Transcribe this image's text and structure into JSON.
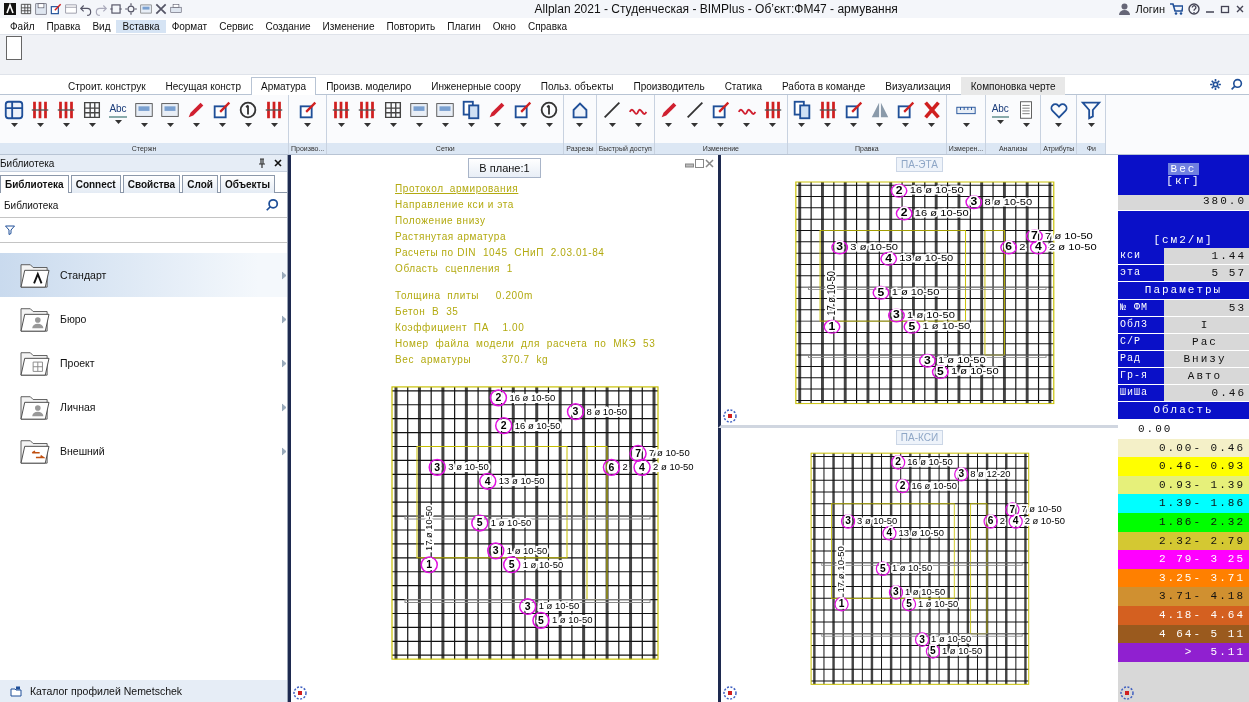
{
  "window": {
    "title": "Allplan 2021 - Студенческая - BIMPlus - Об’єкт:ФМ47 - армування",
    "user": "Логин"
  },
  "quick_tools": [
    {
      "kind": "grid"
    },
    {
      "kind": "save"
    },
    {
      "kind": "edit"
    },
    {
      "kind": "window"
    },
    {
      "kind": "undo"
    },
    {
      "kind": "redo"
    },
    {
      "kind": "frame"
    },
    {
      "kind": "view"
    },
    {
      "kind": "panel"
    },
    {
      "kind": "tools"
    },
    {
      "kind": "print"
    }
  ],
  "menu": [
    {
      "label": "Файл",
      "selected": false
    },
    {
      "label": "Правка",
      "selected": false
    },
    {
      "label": "Вид",
      "selected": false
    },
    {
      "label": "Вставка",
      "selected": true
    },
    {
      "label": "Формат",
      "selected": false
    },
    {
      "label": "Сервис",
      "selected": false
    },
    {
      "label": "Создание",
      "selected": false
    },
    {
      "label": "Изменение",
      "selected": false
    },
    {
      "label": "Повторить",
      "selected": false
    },
    {
      "label": "Плагин",
      "selected": false
    },
    {
      "label": "Окно",
      "selected": false
    },
    {
      "label": "Справка",
      "selected": false
    }
  ],
  "ribbon_tabs": [
    {
      "label": "Строит. конструк",
      "selected": false,
      "kind": "normal"
    },
    {
      "label": "Несущая констр",
      "selected": false,
      "kind": "normal"
    },
    {
      "label": "Арматура",
      "selected": true,
      "kind": "normal"
    },
    {
      "label": "Произв. моделиро",
      "selected": false,
      "kind": "normal"
    },
    {
      "label": "Инженерные соору",
      "selected": false,
      "kind": "normal"
    },
    {
      "label": "Польз. объекты",
      "selected": false,
      "kind": "normal"
    },
    {
      "label": "Производитель",
      "selected": false,
      "kind": "normal"
    },
    {
      "label": "Статика",
      "selected": false,
      "kind": "normal"
    },
    {
      "label": "Работа в команде",
      "selected": false,
      "kind": "normal"
    },
    {
      "label": "Визуализация",
      "selected": false,
      "kind": "normal"
    },
    {
      "label": "Компоновка черте",
      "selected": false,
      "kind": "contextual"
    }
  ],
  "ribbon_groups": [
    {
      "label": "Стержн",
      "tools": [
        {
          "kind": "cube"
        },
        {
          "kind": "bars"
        },
        {
          "kind": "bars"
        },
        {
          "kind": "grid"
        },
        {
          "kind": "text",
          "label": "Abc"
        },
        {
          "kind": "panel"
        },
        {
          "kind": "panel"
        },
        {
          "kind": "pencil"
        },
        {
          "kind": "edit"
        },
        {
          "kind": "number"
        },
        {
          "kind": "bars"
        }
      ]
    },
    {
      "label": "Произво...",
      "tools": [
        {
          "kind": "edit"
        }
      ]
    },
    {
      "label": "Сетки",
      "tools": [
        {
          "kind": "bars"
        },
        {
          "kind": "bars"
        },
        {
          "kind": "grid"
        },
        {
          "kind": "panel"
        },
        {
          "kind": "panel"
        },
        {
          "kind": "copy"
        },
        {
          "kind": "pencil"
        },
        {
          "kind": "edit"
        },
        {
          "kind": "number"
        }
      ]
    },
    {
      "label": "Разрезы",
      "tools": [
        {
          "kind": "house"
        }
      ]
    },
    {
      "label": "Быстрый доступ",
      "tools": [
        {
          "kind": "line"
        },
        {
          "kind": "wave"
        }
      ]
    },
    {
      "label": "Изменение",
      "tools": [
        {
          "kind": "pencil"
        },
        {
          "kind": "line"
        },
        {
          "kind": "edit"
        },
        {
          "kind": "wave"
        },
        {
          "kind": "bars"
        }
      ]
    },
    {
      "label": "Правка",
      "tools": [
        {
          "kind": "copy"
        },
        {
          "kind": "bars"
        },
        {
          "kind": "edit"
        },
        {
          "kind": "mirror"
        },
        {
          "kind": "edit"
        },
        {
          "kind": "cross"
        }
      ]
    },
    {
      "label": "Измерен...",
      "tools": [
        {
          "kind": "ruler"
        }
      ]
    },
    {
      "label": "Анализы",
      "tools": [
        {
          "kind": "text",
          "label": "Abc"
        },
        {
          "kind": "doc"
        }
      ]
    },
    {
      "label": "Атрибуты",
      "tools": [
        {
          "kind": "heart"
        }
      ]
    },
    {
      "label": "Фи",
      "tools": [
        {
          "kind": "funnel"
        }
      ]
    }
  ],
  "library": {
    "title": "Библиотека",
    "tabs": [
      {
        "label": "Библиотека",
        "selected": true
      },
      {
        "label": "Connect",
        "selected": false
      },
      {
        "label": "Свойства",
        "selected": false
      },
      {
        "label": "Слой",
        "selected": false
      },
      {
        "label": "Объекты",
        "selected": false
      }
    ],
    "heading": "Библиотека",
    "items": [
      {
        "label": "Стандарт",
        "selected": true,
        "kind": "logo"
      },
      {
        "label": "Бюро",
        "selected": false,
        "kind": "user"
      },
      {
        "label": "Проект",
        "selected": false,
        "kind": "project"
      },
      {
        "label": "Личная",
        "selected": false,
        "kind": "person"
      },
      {
        "label": "Внешний",
        "selected": false,
        "kind": "external"
      }
    ],
    "footer": "Каталог профилей Nemetschek"
  },
  "viewports": [
    {
      "title": "В плане:1",
      "kind": "main",
      "notes": [
        [
          {
            "text": "Протокол_армирования",
            "kind": "heading"
          },
          {
            "text": "Направление кси и эта",
            "kind": "line"
          },
          {
            "text": "Положение внизу",
            "kind": "line"
          },
          {
            "text": "Растянутая арматура",
            "kind": "line"
          },
          {
            "text": "Расчеты по DIN  1045  СНиП  2.03.01-84",
            "kind": "line"
          },
          {
            "text": "Область  сцепления  1",
            "kind": "line"
          }
        ],
        [
          {
            "text": "Толщина  плиты     0.200m",
            "kind": "line"
          },
          {
            "text": "Бетон  В  35",
            "kind": "line"
          },
          {
            "text": "Коэффициент  ПА    1.00",
            "kind": "line"
          },
          {
            "text": "Номер  файла  модели  для  расчета  по  МКЭ  53",
            "kind": "line"
          },
          {
            "text": "Вес  арматуры         370.7  kg",
            "kind": "line"
          }
        ]
      ],
      "marks": [
        {
          "number": "2",
          "text": "16 ø 10-50"
        },
        {
          "number": "3",
          "text": "8 ø 10-50"
        },
        {
          "number": "2",
          "text": "16 ø 10-50"
        },
        {
          "number": "3",
          "text": "3 ø 10-50"
        },
        {
          "number": "4",
          "text": "13 ø 10-50"
        },
        {
          "number": "6",
          "text": "2"
        },
        {
          "number": "7",
          "text": "7 ø 10-50"
        },
        {
          "number": "4",
          "text": "2 ø 10-50"
        },
        {
          "number": "5",
          "text": "1 ø 10-50"
        },
        {
          "number": "3",
          "text": "1 ø 10-50"
        },
        {
          "number": "5",
          "text": "1 ø 10-50"
        },
        {
          "number": "3",
          "text": "1 ø 10-50"
        },
        {
          "number": "5",
          "text": "1 ø 10-50"
        },
        {
          "number": "1",
          "text": "17 ø 10-50",
          "kind": "vertical"
        }
      ]
    },
    {
      "title": "ПА-ЭТА",
      "kind": "sub",
      "marks": [
        {
          "number": "2",
          "text": "16 ø 10-50"
        },
        {
          "number": "3",
          "text": "8 ø 10-50"
        },
        {
          "number": "2",
          "text": "16 ø 10-50"
        },
        {
          "number": "3",
          "text": "3 ø 10-50"
        },
        {
          "number": "4",
          "text": "13 ø 10-50"
        },
        {
          "number": "6",
          "text": "2"
        },
        {
          "number": "7",
          "text": "7 ø 10-50"
        },
        {
          "number": "4",
          "text": "2 ø 10-50"
        },
        {
          "number": "5",
          "text": "1 ø 10-50"
        },
        {
          "number": "3",
          "text": "1 ø 10-50"
        },
        {
          "number": "5",
          "text": "1 ø 10-50"
        },
        {
          "number": "3",
          "text": "1 ø 10-50"
        },
        {
          "number": "5",
          "text": "1 ø 10-50"
        },
        {
          "number": "1",
          "text": "17 ø 10-50",
          "kind": "vertical"
        }
      ]
    },
    {
      "title": "ПА-КСИ",
      "kind": "sub",
      "marks": [
        {
          "number": "2",
          "text": "16 ø 10-50"
        },
        {
          "number": "3",
          "text": "8 ø 12-20"
        },
        {
          "number": "2",
          "text": "16 ø 10-50"
        },
        {
          "number": "3",
          "text": "3 ø 10-50"
        },
        {
          "number": "4",
          "text": "13 ø 10-50"
        },
        {
          "number": "6",
          "text": "2"
        },
        {
          "number": "7",
          "text": "7 ø 10-50"
        },
        {
          "number": "4",
          "text": "2 ø 10-50"
        },
        {
          "number": "5",
          "text": "1 ø 10-50"
        },
        {
          "number": "3",
          "text": "1 ø 10-50"
        },
        {
          "number": "5",
          "text": "1 ø 10-50"
        },
        {
          "number": "3",
          "text": "1 ø 10-50"
        },
        {
          "number": "5",
          "text": "1 ø 10-50"
        },
        {
          "number": "1",
          "text": "17 ø 10-50",
          "kind": "vertical"
        }
      ]
    }
  ],
  "legend": {
    "title": "Вес",
    "unit": "[кг]",
    "weight": "380.0",
    "area_unit": "[см2/м]",
    "values": [
      {
        "label": "кси",
        "value": "1.44"
      },
      {
        "label": "эта",
        "value": "5 57"
      }
    ],
    "params_title": "Параметры",
    "params": [
      {
        "label": "№ ФМ",
        "value": "53"
      },
      {
        "label": "Обл3",
        "value": "I"
      },
      {
        "label": "С/Р",
        "value": "Рас"
      },
      {
        "label": "Рад",
        "value": "Внизу"
      },
      {
        "label": "Гр-я",
        "value": "Авто"
      },
      {
        "label": "ШиШа",
        "value": "0.46"
      }
    ],
    "area_title": "Область",
    "scale": [
      {
        "label": "0.00",
        "color": "#ffffff"
      },
      {
        "label": "0.00- 0.46",
        "color": "#f4f0c8"
      },
      {
        "label": "0.46- 0.93",
        "color": "#ffff00"
      },
      {
        "label": "0.93- 1.39",
        "color": "#e6f07a"
      },
      {
        "label": "1.39- 1.86",
        "color": "#00ffff"
      },
      {
        "label": "1.86- 2.32",
        "color": "#00ff00"
      },
      {
        "label": "2.32- 2.79",
        "color": "#d4c832"
      },
      {
        "label": "2 79- 3 25",
        "color": "#ff00ff"
      },
      {
        "label": "3.25- 3.71",
        "color": "#ff8000"
      },
      {
        "label": "3.71- 4.18",
        "color": "#d09030"
      },
      {
        "label": "4.18- 4.64",
        "color": "#d46020"
      },
      {
        "label": "4 64- 5 11",
        "color": "#9a5a1e"
      },
      {
        "label": ">  5.11",
        "color": "#9020d0"
      }
    ]
  }
}
